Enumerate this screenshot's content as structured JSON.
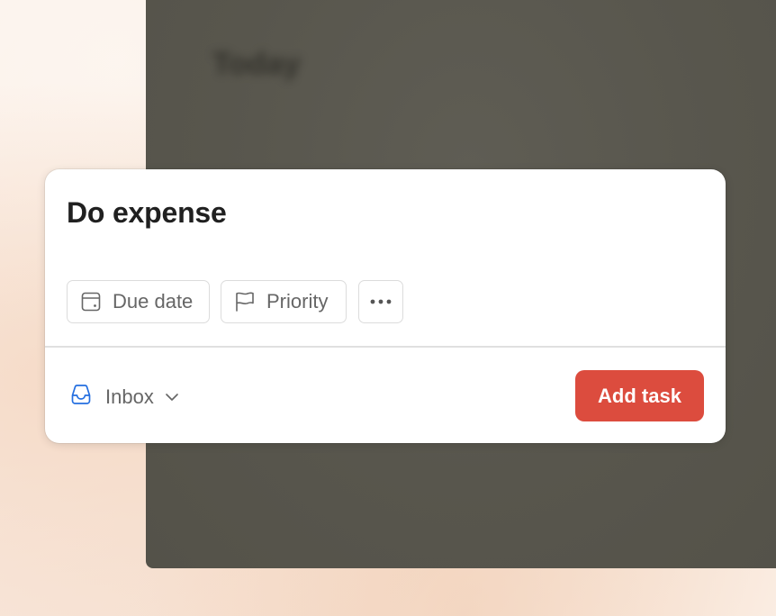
{
  "background": {
    "window_title": "Today"
  },
  "quick_add": {
    "task_name": "Do expense",
    "chips": {
      "due_date": {
        "label": "Due date",
        "icon": "calendar-icon"
      },
      "priority": {
        "label": "Priority",
        "icon": "flag-icon"
      },
      "more": {
        "icon": "more-horizontal-icon"
      }
    },
    "project": {
      "label": "Inbox",
      "icon": "inbox-icon",
      "chevron": "chevron-down-icon"
    },
    "submit_label": "Add task"
  },
  "colors": {
    "accent": "#dc4c3e",
    "inbox_icon": "#246fe0",
    "chip_text": "#666666",
    "task_text": "#202020"
  }
}
